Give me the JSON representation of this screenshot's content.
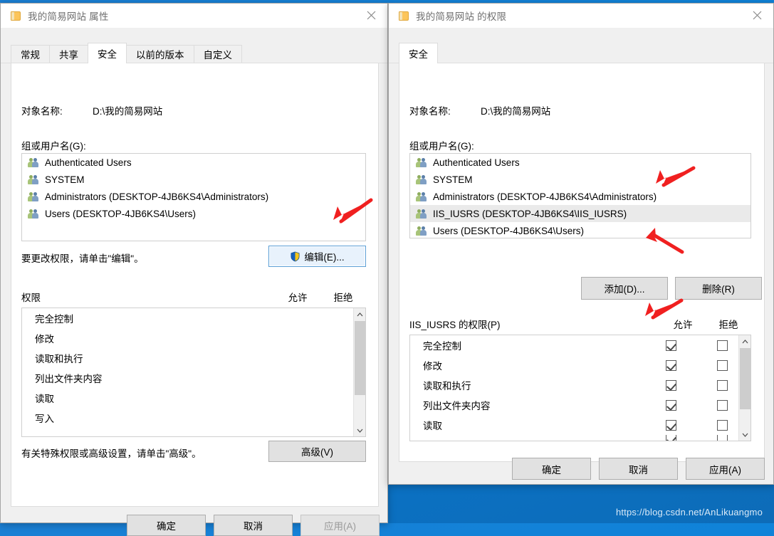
{
  "desktop": {
    "watermark": "https://blog.csdn.net/AnLikuangmo",
    "background_color": "#0f83d9"
  },
  "properties_dialog": {
    "title": "我的简易网站 属性",
    "icon": "folder-icon",
    "close_label": "✕",
    "tabs": [
      {
        "label": "常规",
        "active": false
      },
      {
        "label": "共享",
        "active": false
      },
      {
        "label": "安全",
        "active": true
      },
      {
        "label": "以前的版本",
        "active": false
      },
      {
        "label": "自定义",
        "active": false
      }
    ],
    "object_name_label": "对象名称:",
    "object_name_value": "D:\\我的简易网站",
    "groups_label": "组或用户名(G):",
    "groups": [
      "Authenticated Users",
      "SYSTEM",
      "Administrators (DESKTOP-4JB6KS4\\Administrators)",
      "Users (DESKTOP-4JB6KS4\\Users)"
    ],
    "edit_hint": "要更改权限，请单击\"编辑\"。",
    "edit_button": "编辑(E)...",
    "permissions_label": "权限",
    "allow_header": "允许",
    "deny_header": "拒绝",
    "permissions": [
      "完全控制",
      "修改",
      "读取和执行",
      "列出文件夹内容",
      "读取",
      "写入"
    ],
    "advanced_hint": "有关特殊权限或高级设置，请单击\"高级\"。",
    "advanced_button": "高级(V)",
    "footer": {
      "ok": "确定",
      "cancel": "取消",
      "apply": "应用(A)",
      "apply_disabled": true
    }
  },
  "permissions_dialog": {
    "title": "我的简易网站 的权限",
    "icon": "folder-icon",
    "close_label": "✕",
    "tabs": [
      {
        "label": "安全",
        "active": true
      }
    ],
    "object_name_label": "对象名称:",
    "object_name_value": "D:\\我的简易网站",
    "groups_label": "组或用户名(G):",
    "groups": [
      {
        "name": "Authenticated Users",
        "selected": false
      },
      {
        "name": "SYSTEM",
        "selected": false
      },
      {
        "name": "Administrators (DESKTOP-4JB6KS4\\Administrators)",
        "selected": false
      },
      {
        "name": "IIS_IUSRS (DESKTOP-4JB6KS4\\IIS_IUSRS)",
        "selected": true
      },
      {
        "name": "Users (DESKTOP-4JB6KS4\\Users)",
        "selected": false
      }
    ],
    "add_button": "添加(D)...",
    "remove_button": "删除(R)",
    "permissions_label": "IIS_IUSRS 的权限(P)",
    "allow_header": "允许",
    "deny_header": "拒绝",
    "permissions": [
      {
        "name": "完全控制",
        "allow": true,
        "deny": false
      },
      {
        "name": "修改",
        "allow": true,
        "deny": false
      },
      {
        "name": "读取和执行",
        "allow": true,
        "deny": false
      },
      {
        "name": "列出文件夹内容",
        "allow": true,
        "deny": false
      },
      {
        "name": "读取",
        "allow": true,
        "deny": false
      }
    ],
    "footer": {
      "ok": "确定",
      "cancel": "取消",
      "apply": "应用(A)",
      "apply_disabled": false
    }
  },
  "annotations": {
    "color": "#f02020",
    "arrows": [
      {
        "name": "arrow-to-edit-button"
      },
      {
        "name": "arrow-to-iis-iusrs-row"
      },
      {
        "name": "arrow-to-add-button"
      },
      {
        "name": "arrow-to-allow-checkbox"
      }
    ]
  }
}
